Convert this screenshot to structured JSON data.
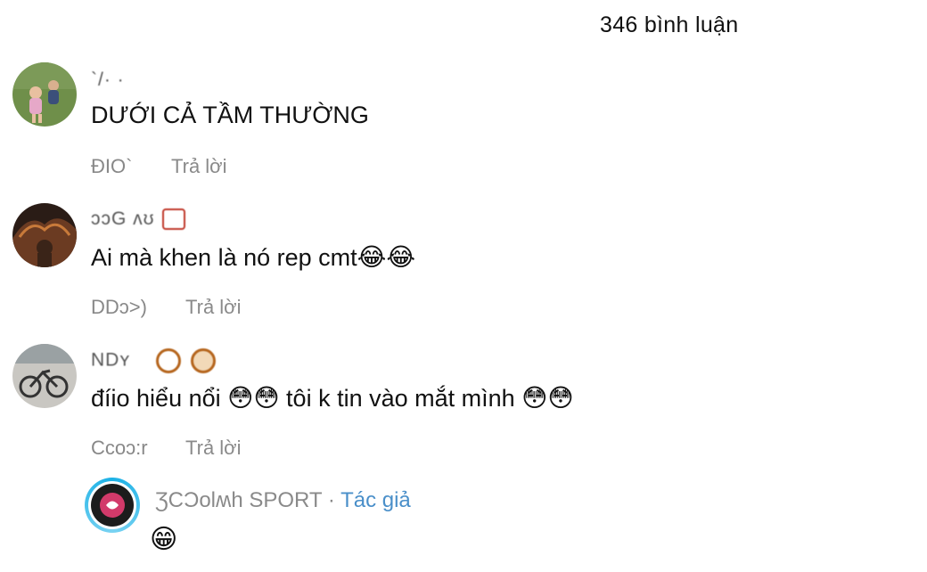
{
  "header": {
    "comment_count": "346 bình luận"
  },
  "comments": [
    {
      "username": "`/· ·",
      "text": "DƯỚI CẢ TẦM THƯỜNG",
      "time": "ĐIO`",
      "reply_label": "Trả lời"
    },
    {
      "username": "ɔɔG ʌʊ",
      "text": "Ai mà khen là nó rep cmt",
      "emoji": "😂😂",
      "time": "DDɔ>)",
      "reply_label": "Trả lời"
    },
    {
      "username": "NDʏ",
      "text_a": "đíio hiểu nổi",
      "emoji_a": "😳😳",
      "text_b": "tôi k tin vào mắt mình",
      "emoji_b": "😳😳",
      "time": "Ccoɔ:r",
      "reply_label": "Trả lời"
    }
  ],
  "reply": {
    "username": "ƷCƆolʍh SPORT",
    "separator": " · ",
    "author_tag": "Tác giả",
    "emoji": "😁"
  }
}
